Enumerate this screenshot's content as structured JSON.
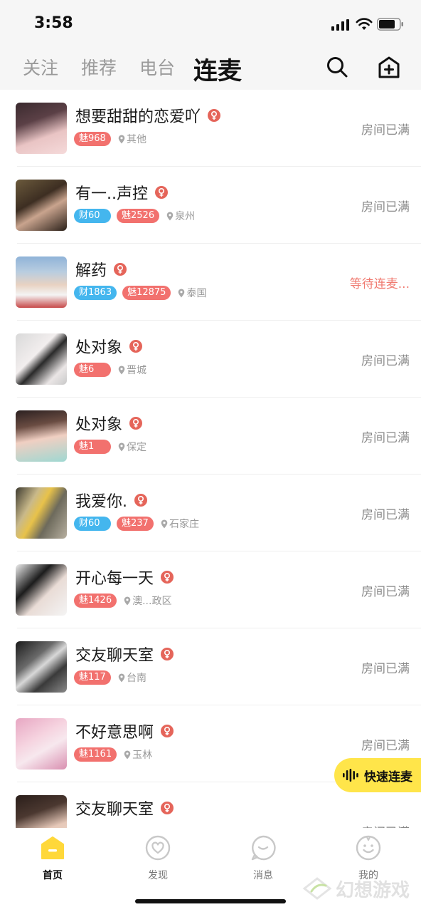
{
  "status_bar": {
    "time": "3:58"
  },
  "top_nav": {
    "tabs": [
      {
        "label": "关注"
      },
      {
        "label": "推荐"
      },
      {
        "label": "电台"
      },
      {
        "label": "连麦"
      }
    ],
    "active_tab": "连麦"
  },
  "rooms": [
    {
      "title": "想要甜甜的恋爱吖",
      "wealth": "",
      "charm": "魅968",
      "location": "其他",
      "status": "房间已满"
    },
    {
      "title": "有一..声控",
      "wealth": "财60",
      "charm": "魅2526",
      "location": "泉州",
      "status": "房间已满"
    },
    {
      "title": "解药",
      "wealth": "财1863",
      "charm": "魅12875",
      "location": "泰国",
      "status": "等待连麦..."
    },
    {
      "title": "处对象",
      "wealth": "",
      "charm": "魅6",
      "location": "晋城",
      "status": "房间已满"
    },
    {
      "title": "处对象",
      "wealth": "",
      "charm": "魅1",
      "location": "保定",
      "status": "房间已满"
    },
    {
      "title": "我爱你.",
      "wealth": "财60",
      "charm": "魅237",
      "location": "石家庄",
      "status": "房间已满"
    },
    {
      "title": "开心每一天",
      "wealth": "",
      "charm": "魅1426",
      "location": "澳...政区",
      "status": "房间已满"
    },
    {
      "title": "交友聊天室",
      "wealth": "",
      "charm": "魅117",
      "location": "台南",
      "status": "房间已满"
    },
    {
      "title": "不好意思啊",
      "wealth": "",
      "charm": "魅1161",
      "location": "玉林",
      "status": "房间已满"
    },
    {
      "title": "交友聊天室",
      "wealth": "",
      "charm": "",
      "location": "",
      "status": "房间已满"
    }
  ],
  "quick_mic": {
    "label": "快速连麦"
  },
  "bottom_nav": {
    "items": [
      {
        "label": "首页",
        "icon": "home-icon"
      },
      {
        "label": "发现",
        "icon": "discover-heart-icon"
      },
      {
        "label": "消息",
        "icon": "message-bubble-icon"
      },
      {
        "label": "我的",
        "icon": "profile-smile-icon"
      }
    ],
    "active": "首页"
  },
  "watermark": {
    "text": "幻想游戏"
  },
  "colors": {
    "accent_yellow": "#ffe54a",
    "home_icon_yellow": "#ffd83a",
    "charm_tag": "#f2716e",
    "wealth_tag": "#44b6ee",
    "female_icon": "#e5655a",
    "waiting_status": "#f07a70"
  }
}
